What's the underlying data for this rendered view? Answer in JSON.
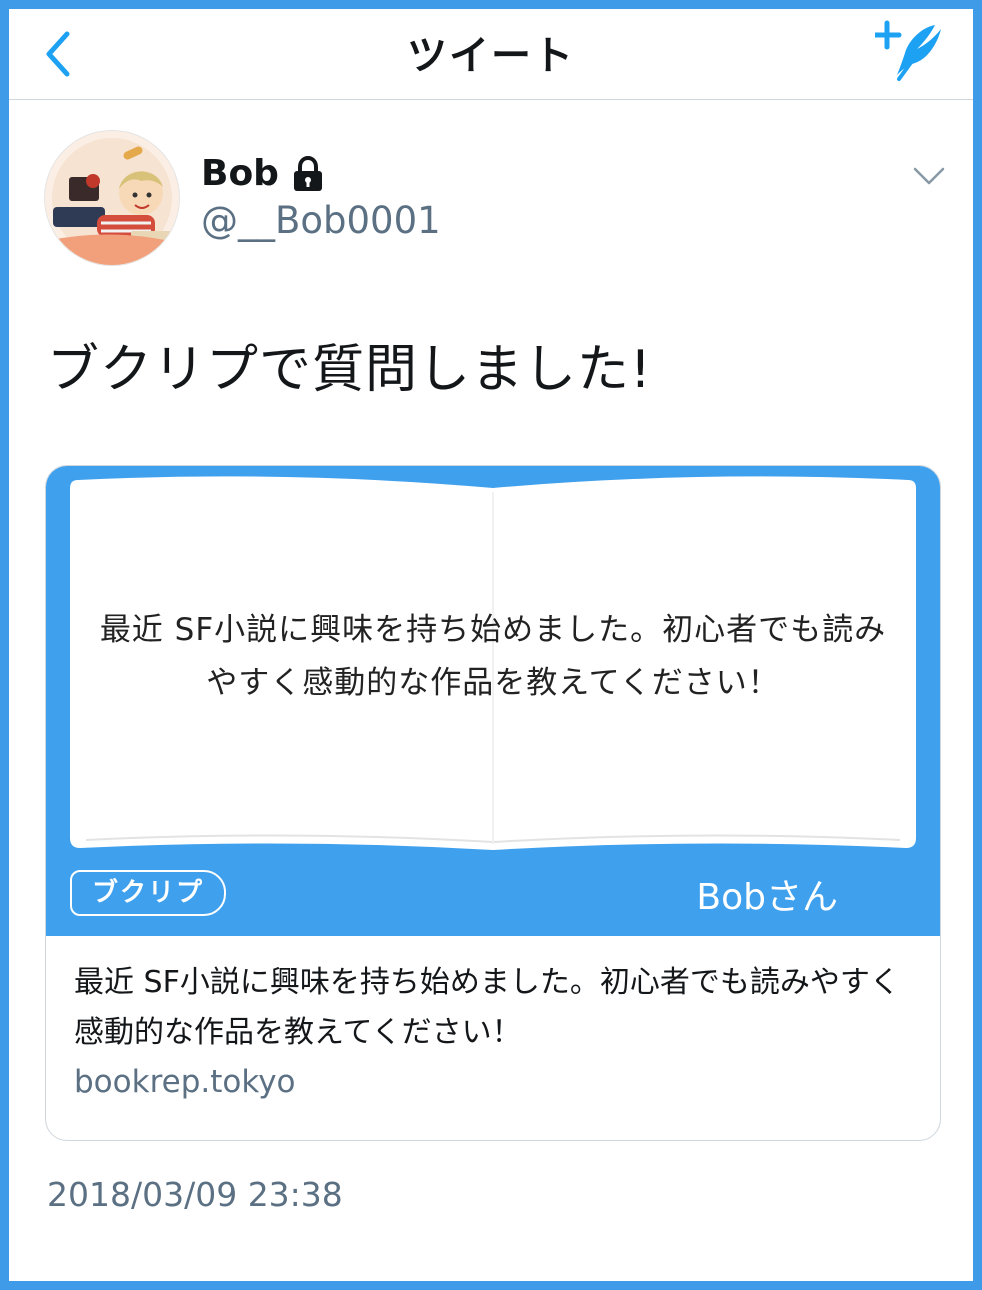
{
  "header": {
    "title": "ツイート",
    "back_icon": "chevron-left-icon",
    "compose_icon": "compose-tweet-icon",
    "accent": "#1da1f2"
  },
  "author": {
    "display_name": "Bob",
    "handle": "@__Bob0001",
    "protected": true,
    "lock_icon": "lock-icon",
    "menu_icon": "chevron-down-icon"
  },
  "tweet": {
    "text": "ブクリプで質問しました!",
    "timestamp": "2018/03/09 23:38"
  },
  "card": {
    "image": {
      "question": "最近 SF小説に興味を持ち始めました。初心者でも読みやすく感動的な作品を教えてください！",
      "brand": "ブクリプ",
      "asker": "Bobさん",
      "background_color": "#3fa0ee"
    },
    "description": "最近 SF小説に興味を持ち始めました。初心者でも読みやすく感動的な作品を教えてください！",
    "domain": "bookrep.tokyo"
  }
}
